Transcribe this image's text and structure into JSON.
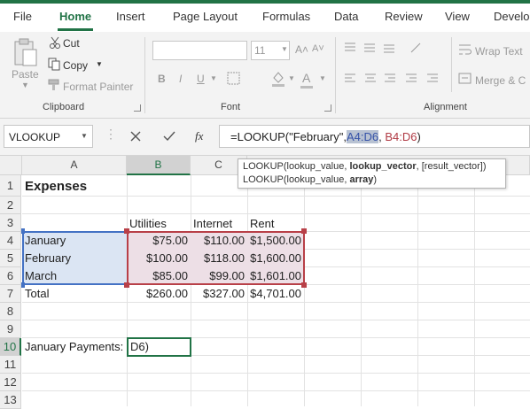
{
  "menu": {
    "tabs": [
      "File",
      "Home",
      "Insert",
      "Page Layout",
      "Formulas",
      "Data",
      "Review",
      "View",
      "Develo"
    ],
    "active": "Home"
  },
  "clipboard": {
    "paste": "Paste",
    "cut": "Cut",
    "copy": "Copy",
    "format_painter": "Format Painter",
    "group_label": "Clipboard"
  },
  "font": {
    "size": "11",
    "grow": "A˄",
    "shrink": "A˅",
    "bold": "B",
    "italic": "I",
    "underline": "U",
    "color_letter": "A",
    "group_label": "Font"
  },
  "alignment": {
    "wrap_text": "Wrap Text",
    "merge": "Merge & C",
    "group_label": "Alignment"
  },
  "formula_bar": {
    "name_box": "VLOOKUP",
    "fx": "fx",
    "parts": {
      "prefix": "=LOOKUP(\"February\",",
      "ref1": "A4:D6",
      "sep": ", ",
      "ref2": "B4:D6",
      "suffix": ")"
    }
  },
  "tooltip": {
    "line1_a": "LOOKUP(lookup_value, ",
    "line1_b": "lookup_vector",
    "line1_c": ", [result_vector])",
    "line2_a": "LOOKUP(lookup_value, ",
    "line2_b": "array",
    "line2_c": ")"
  },
  "columns": [
    "A",
    "B",
    "C"
  ],
  "rows": [
    "1",
    "2",
    "3",
    "4",
    "5",
    "6",
    "7",
    "8",
    "9",
    "10",
    "11",
    "12",
    "13"
  ],
  "sheet": {
    "title": "Expenses",
    "headers": {
      "b": "Utilities",
      "c": "Internet",
      "d": "Rent"
    },
    "data": [
      {
        "a": "January",
        "b": "$75.00",
        "c": "$110.00",
        "d": "$1,500.00"
      },
      {
        "a": "February",
        "b": "$100.00",
        "c": "$118.00",
        "d": "$1,600.00"
      },
      {
        "a": "March",
        "b": "$85.00",
        "c": "$99.00",
        "d": "$1,601.00"
      },
      {
        "a": "Total",
        "b": "$260.00",
        "c": "$327.00",
        "d": "$4,701.00"
      }
    ],
    "jan_label": "January Payments:",
    "edit_value": "D6)"
  },
  "colors": {
    "accent": "#217346",
    "ref_blue": "#4472c4",
    "ref_red": "#b84048",
    "blue_fill": "#dbe5f3",
    "red_fill": "#eddfe6"
  }
}
